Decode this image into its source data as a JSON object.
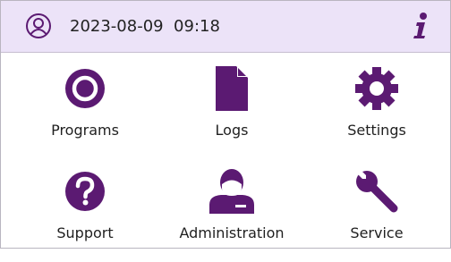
{
  "header": {
    "datetime": "2023-08-09  09:18",
    "user_icon": "user-account-icon",
    "info_icon": "info-icon"
  },
  "colors": {
    "accent": "#5b1a72",
    "header_bg": "#ece3f8",
    "text": "#1f1f1f"
  },
  "menu": {
    "items": [
      {
        "label": "Programs",
        "icon": "programs-icon"
      },
      {
        "label": "Logs",
        "icon": "logs-icon"
      },
      {
        "label": "Settings",
        "icon": "settings-icon"
      },
      {
        "label": "Support",
        "icon": "support-icon"
      },
      {
        "label": "Administration",
        "icon": "administration-icon"
      },
      {
        "label": "Service",
        "icon": "service-icon"
      }
    ]
  }
}
